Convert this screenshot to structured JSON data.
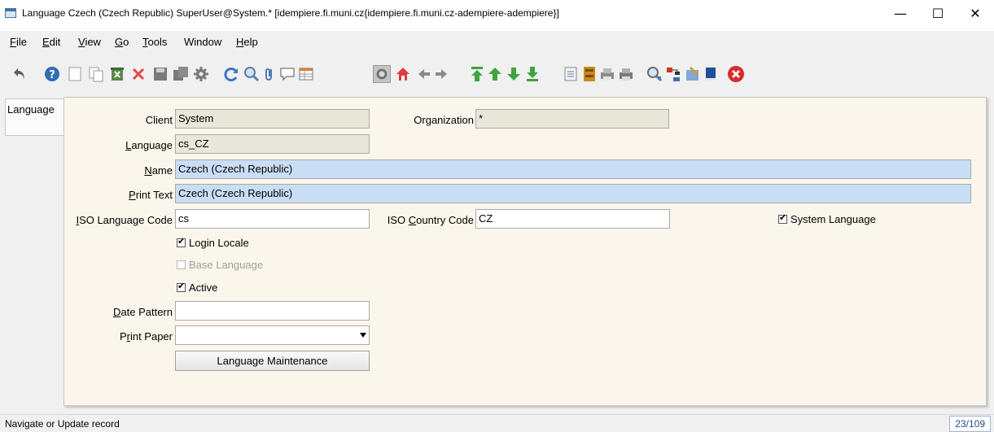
{
  "window": {
    "title": "Language  Czech (Czech Republic)  SuperUser@System.* [idempiere.fi.muni.cz{idempiere.fi.muni.cz-adempiere-adempiere}]",
    "minimize": "—",
    "maximize": "☐",
    "close": "✕"
  },
  "menu": [
    {
      "mnemonic": "F",
      "rest": "ile"
    },
    {
      "mnemonic": "E",
      "rest": "dit"
    },
    {
      "mnemonic": "V",
      "rest": "iew"
    },
    {
      "mnemonic": "G",
      "rest": "o"
    },
    {
      "mnemonic": "T",
      "rest": "ools"
    },
    {
      "mnemonic": "",
      "rest": "Window"
    },
    {
      "mnemonic": "H",
      "rest": "elp"
    }
  ],
  "toolbar_icons": [
    "undo-icon",
    "help-icon",
    "new-record-icon",
    "copy-record-icon",
    "delete-selection-icon",
    "delete-icon",
    "save-icon",
    "save-and-new-icon",
    "customize-icon",
    "refresh-icon",
    "find-icon",
    "attachment-icon",
    "chat-icon",
    "grid-toggle-icon",
    "history-icon",
    "home-icon",
    "previous-icon",
    "next-icon",
    "first-record-icon",
    "parent-record-icon",
    "detail-record-icon",
    "last-record-icon",
    "report-icon",
    "archive-icon",
    "print-preview-icon",
    "print-icon",
    "zoom-across-icon",
    "workflow-icon",
    "requests-icon",
    "product-info-icon",
    "exit-icon"
  ],
  "tab": {
    "label": "Language"
  },
  "form": {
    "client_label": "Client",
    "client_value": "System",
    "org_label": "Organization",
    "org_value": "*",
    "language_label_mn": "L",
    "language_label_rest": "anguage",
    "language_value": "cs_CZ",
    "name_label_mn": "N",
    "name_label_rest": "ame",
    "name_value": "Czech (Czech Republic)",
    "printtext_label_mn": "P",
    "printtext_label_rest": "rint Text",
    "printtext_value": "Czech (Czech Republic)",
    "isolang_label_mn": "I",
    "isolang_label_rest": "SO Language Code",
    "isolang_value": "cs",
    "isocountry_label_pre": "ISO ",
    "isocountry_label_mn": "C",
    "isocountry_label_rest": "ountry Code",
    "isocountry_value": "CZ",
    "system_language": "System Language",
    "login_locale": "Login Locale",
    "base_language": "Base Language",
    "active": "Active",
    "datepattern_label_mn": "D",
    "datepattern_label_rest": "ate Pattern",
    "datepattern_value": "",
    "printpaper_label_pre": "P",
    "printpaper_label_mn": "r",
    "printpaper_label_rest": "int Paper",
    "printpaper_value": "",
    "maintenance_button": "Language Maintenance"
  },
  "status": {
    "message": "Navigate or Update record",
    "record_count": "23/109"
  }
}
